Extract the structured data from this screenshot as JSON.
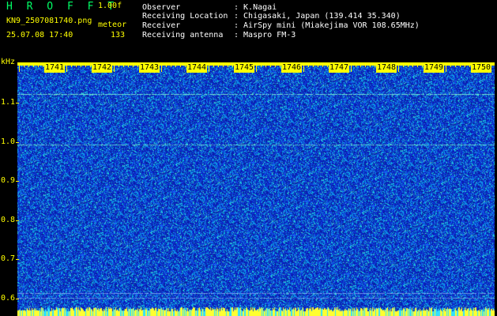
{
  "header": {
    "brand": "H R O F F T",
    "version": "1.00f",
    "filename": "KN9_2507081740.png",
    "mode": "meteor",
    "datetime": "25.07.08 17:40",
    "count": "133"
  },
  "info": [
    {
      "label": "Observer",
      "value": ": K.Nagai"
    },
    {
      "label": "Receiving Location",
      "value": ": Chigasaki, Japan (139.414 35.340)"
    },
    {
      "label": "Receiver",
      "value": ": AirSpy mini (Miakejima VOR 108.65MHz)"
    },
    {
      "label": "Receiving antenna",
      "value": ": Maspro FM-3"
    }
  ],
  "y_axis": {
    "unit": "kHz",
    "ticks": [
      "1.1",
      "1.0",
      "0.9",
      "0.8",
      "0.7",
      "0.6"
    ]
  },
  "time_axis": {
    "ticks": [
      "1741",
      "1742",
      "1743",
      "1744",
      "1745",
      "1746",
      "1747",
      "1748",
      "1749",
      "1750"
    ]
  },
  "colors": {
    "background": "#000000",
    "noise": "#0a1aa8",
    "accent": "#ffff00",
    "signal": "#00e0ff"
  }
}
